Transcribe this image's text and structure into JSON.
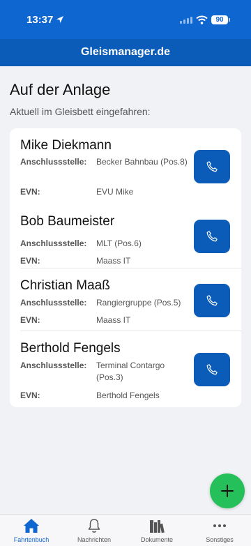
{
  "status": {
    "time": "13:37",
    "battery": "90"
  },
  "header": {
    "title": "Gleismanager.de"
  },
  "page": {
    "title": "Auf der Anlage",
    "subtitle": "Aktuell im Gleisbett eingefahren:"
  },
  "labels": {
    "anschluss": "Anschlussstelle:",
    "evn": "EVN:"
  },
  "persons": [
    {
      "name": "Mike Diekmann",
      "anschluss": "Becker Bahnbau (Pos.8)",
      "evn": "EVU Mike"
    },
    {
      "name": "Bob Baumeister",
      "anschluss": "MLT (Pos.6)",
      "evn": "Maass IT"
    },
    {
      "name": "Christian Maaß",
      "anschluss": "Rangiergruppe (Pos.5)",
      "evn": "Maass IT"
    },
    {
      "name": "Berthold Fengels",
      "anschluss": "Terminal Contargo (Pos.3)",
      "evn": "Berthold Fengels"
    }
  ],
  "tabs": [
    {
      "label": "Fahrtenbuch",
      "icon": "home-icon",
      "active": true
    },
    {
      "label": "Nachrichten",
      "icon": "bell-icon"
    },
    {
      "label": "Dokumente",
      "icon": "books-icon"
    },
    {
      "label": "Sonstiges",
      "icon": "more-icon"
    }
  ],
  "colors": {
    "primary": "#0e66d0",
    "header": "#0b5cb8",
    "fab": "#25c05a",
    "background": "#f1f2f6"
  }
}
